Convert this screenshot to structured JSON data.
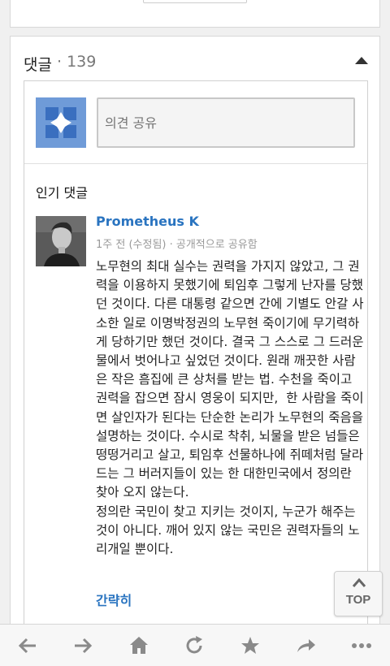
{
  "comments": {
    "title": "댓글",
    "count": "· 139",
    "share_placeholder": "의견 공유",
    "popular_label": "인기 댓글",
    "items": [
      {
        "author": "Prometheus K",
        "meta": "1주 전 (수정됨)  ·  공개적으로 공유함",
        "body": "노무현의 최대 실수는 권력을 가지지 않았고, 그 권력을 이용하지 못했기에 퇴임후 그렇게 난자를 당했던 것이다. 다른 대통령 같으면 간에 기별도 안갈 사소한 일로 이명박정권의 노무현 죽이기에 무기력하게 당하기만 했던 것이다. 결국 그 스스로 그 드러운 물에서 벗어나고 싶었던 것이다. 원래 깨끗한 사람은 작은 흠집에 큰 상처를 받는 법. 수천을 죽이고 권력을 잡으면 잠시 영웅이 되지만,  한 사람을 죽이면 살인자가 된다는 단순한 논리가 노무현의 죽음을 설명하는 것이다. 수시로 착취, 뇌물을 받은 넘들은 떵떵거리고 살고, 퇴임후 선물하나에 쥐떼처럼 달라드는 그 버러지들이 있는 한 대한민국에서 정의란 찾아 오지 않는다.\n정의란 국민이 찾고 지키는 것이지, 누군가 해주는 것이 아니다. 깨어 있지 않는 국민은 권력자들의 노리개일 뿐이다.",
        "collapse_label": "간략히"
      }
    ]
  },
  "scroll_top": {
    "label": "TOP"
  },
  "bottom_nav": {
    "items": [
      {
        "icon": "back-arrow-icon"
      },
      {
        "icon": "forward-arrow-icon"
      },
      {
        "icon": "home-icon"
      },
      {
        "icon": "refresh-icon"
      },
      {
        "icon": "star-icon"
      },
      {
        "icon": "share-icon"
      },
      {
        "icon": "more-icon"
      }
    ]
  },
  "colors": {
    "link": "#2a74c0",
    "avatar_blue": "#6f9bd8",
    "icon_gray": "#8a8a8a"
  }
}
